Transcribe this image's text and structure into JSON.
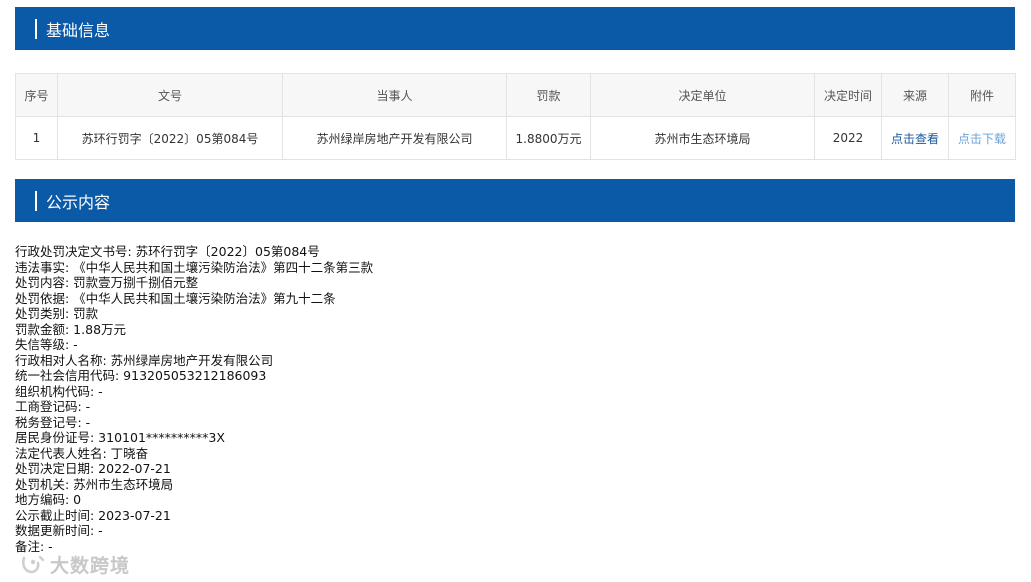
{
  "section1": {
    "title": "基础信息"
  },
  "table": {
    "headers": [
      "序号",
      "文号",
      "当事人",
      "罚款",
      "决定单位",
      "决定时间",
      "来源",
      "附件"
    ],
    "row": {
      "index": "1",
      "doc_no": "苏环行罚字〔2022〕05第084号",
      "party": "苏州绿岸房地产开发有限公司",
      "fine": "1.8800万元",
      "authority": "苏州市生态环境局",
      "date": "2022",
      "source_link": "点击查看",
      "attachment_link": "点击下载"
    }
  },
  "section2": {
    "title": "公示内容"
  },
  "content_lines": [
    "行政处罚决定文书号: 苏环行罚字〔2022〕05第084号",
    "违法事实: 《中华人民共和国土壤污染防治法》第四十二条第三款",
    "处罚内容: 罚款壹万捌千捌佰元整",
    "处罚依据: 《中华人民共和国土壤污染防治法》第九十二条",
    "处罚类别: 罚款",
    "罚款金额: 1.88万元",
    "失信等级: -",
    "行政相对人名称: 苏州绿岸房地产开发有限公司",
    "统一社会信用代码: 913205053212186093",
    "组织机构代码: -",
    "工商登记码: -",
    "税务登记号: -",
    "居民身份证号: 310101**********3X",
    "法定代表人姓名: 丁晓奋",
    "处罚决定日期: 2022-07-21",
    "处罚机关: 苏州市生态环境局",
    "地方编码: 0",
    "公示截止时间: 2023-07-21",
    "数据更新时间: -",
    "备注: -"
  ],
  "watermark": {
    "text": "大数跨境",
    "icon": "brand-logo-icon"
  },
  "colors": {
    "header_bg": "#0b5aa8",
    "link": "#1b5aa0",
    "link_light": "#6aa3d8"
  }
}
